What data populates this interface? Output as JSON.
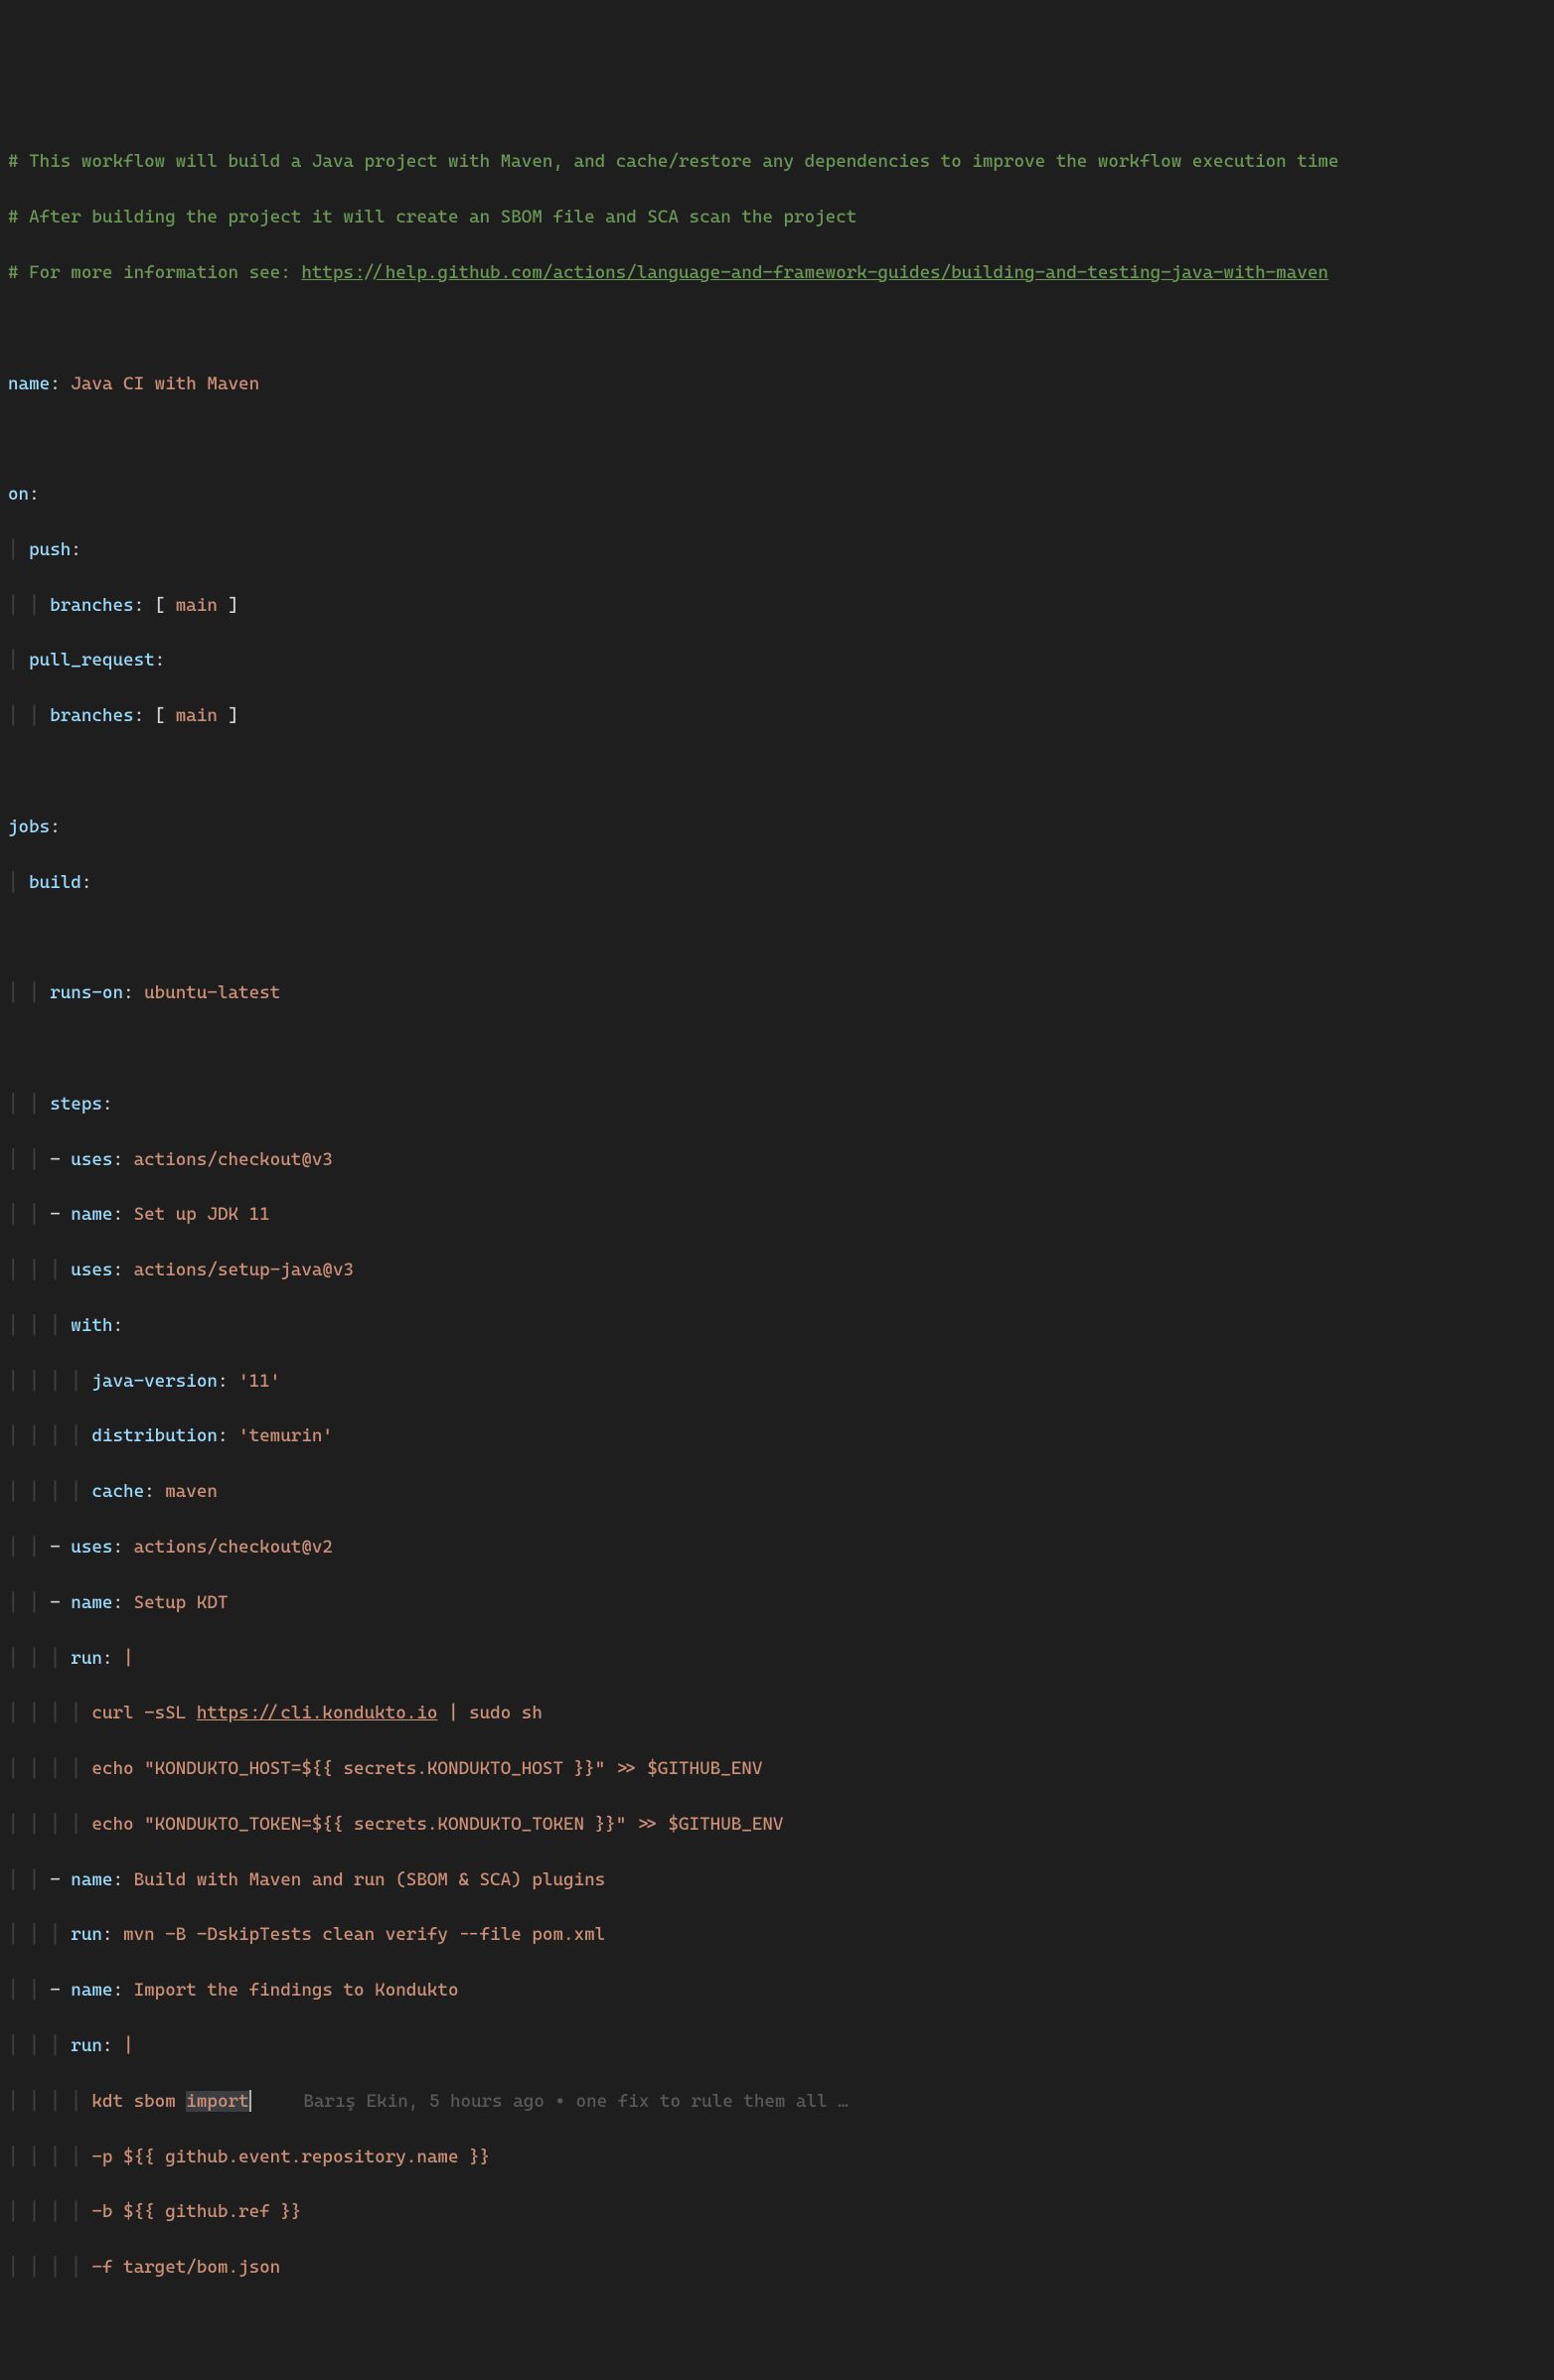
{
  "code": {
    "comments": {
      "line1": "# This workflow will build a Java project with Maven, and cache/restore any dependencies to improve the workflow execution time",
      "line2": "# After building the project it will create an SBOM file and SCA scan the project",
      "line3_prefix": "# For more information see: ",
      "line3_url": "https://help.github.com/actions/language-and-framework-guides/building-and-testing-java-with-maven"
    },
    "name_key": "name",
    "name_val": "Java CI with Maven",
    "on_key": "on",
    "push_key": "push",
    "branches_key": "branches",
    "branch_main": "main",
    "pull_request_key": "pull_request",
    "jobs_key": "jobs",
    "build_key": "build",
    "runs_on_key": "runs-on",
    "runs_on_val": "ubuntu-latest",
    "steps_key": "steps",
    "uses_key": "uses",
    "uses_checkout_v3": "actions/checkout@v3",
    "step_name_key": "name",
    "setup_jdk": "Set up JDK 11",
    "setup_java_uses": "actions/setup-java@v3",
    "with_key": "with",
    "java_version_key": "java-version",
    "java_version_val": "'11'",
    "distribution_key": "distribution",
    "distribution_val": "'temurin'",
    "cache_key": "cache",
    "cache_val": "maven",
    "uses_checkout_v2": "actions/checkout@v2",
    "setup_kdt": "Setup KDT",
    "run_key": "run",
    "pipe": "|",
    "curl_pre": "curl -sSL ",
    "curl_url": "https://cli.kondukto.io",
    "curl_post": " | sudo sh",
    "echo_host": "echo \"KONDUKTO_HOST=${{ secrets.KONDUKTO_HOST }}\" >> $GITHUB_ENV",
    "echo_token": "echo \"KONDUKTO_TOKEN=${{ secrets.KONDUKTO_TOKEN }}\" >> $GITHUB_ENV",
    "build_maven": "Build with Maven and run (SBOM & SCA) plugins",
    "mvn_cmd": "mvn -B -DskipTests clean verify --file pom.xml",
    "import_findings": "Import the findings to Kondukto",
    "kdt_pre": "kdt sbom ",
    "kdt_import": "import",
    "p_arg": "-p ${{ github.event.repository.name }}",
    "b_arg": "-b ${{ github.ref }}",
    "f_arg": "-f target/bom.json"
  },
  "blame": {
    "author": "Barış Ekin",
    "when": "5 hours ago",
    "msg": "one fix to rule them all …"
  }
}
